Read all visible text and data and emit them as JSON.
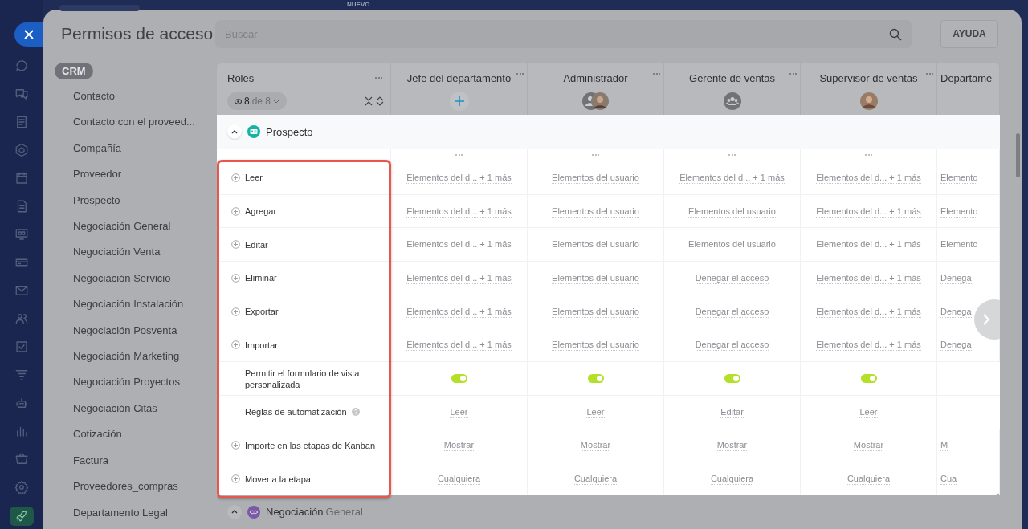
{
  "top_bar": {
    "badge": "NUEVO"
  },
  "title": "Permisos de acceso",
  "search": {
    "placeholder": "Buscar"
  },
  "help_button": "AYUDA",
  "nav": {
    "section": "CRM",
    "items": [
      "Contacto",
      "Contacto con el proveed...",
      "Compañía",
      "Proveedor",
      "Prospecto",
      "Negociación General",
      "Negociación Venta",
      "Negociación Servicio",
      "Negociación Instalación",
      "Negociación Posventa",
      "Negociación Marketing",
      "Negociación Proyectos",
      "Negociación Citas",
      "Cotización",
      "Factura",
      "Proveedores_compras",
      "Departamento Legal"
    ]
  },
  "roles_header": {
    "label": "Roles",
    "visible": "8",
    "total": "de 8"
  },
  "role_columns": [
    {
      "name": "Jefe del departamento",
      "kind": "add"
    },
    {
      "name": "Administrador",
      "kind": "pair"
    },
    {
      "name": "Gerente de ventas",
      "kind": "group"
    },
    {
      "name": "Supervisor de ventas",
      "kind": "person"
    },
    {
      "name": "Departame",
      "kind": "partial"
    }
  ],
  "group": {
    "name": "Prospecto",
    "expanded": true
  },
  "rows": [
    {
      "label": "Leer",
      "kind": "expandable",
      "cells": [
        {
          "kind": "text",
          "text": "Elementos del d... + 1 más"
        },
        {
          "kind": "text",
          "text": "Elementos del usuario"
        },
        {
          "kind": "text",
          "text": "Elementos del d... + 1 más"
        },
        {
          "kind": "text",
          "text": "Elementos del d... + 1 más"
        },
        {
          "kind": "text",
          "text": "Elemento"
        }
      ]
    },
    {
      "label": "Agregar",
      "kind": "expandable",
      "cells": [
        {
          "kind": "text",
          "text": "Elementos del d... + 1 más"
        },
        {
          "kind": "text",
          "text": "Elementos del usuario"
        },
        {
          "kind": "text",
          "text": "Elementos del usuario"
        },
        {
          "kind": "text",
          "text": "Elementos del d... + 1 más"
        },
        {
          "kind": "text",
          "text": "Elemento"
        }
      ]
    },
    {
      "label": "Editar",
      "kind": "expandable",
      "cells": [
        {
          "kind": "text",
          "text": "Elementos del d... + 1 más"
        },
        {
          "kind": "text",
          "text": "Elementos del usuario"
        },
        {
          "kind": "text",
          "text": "Elementos del usuario"
        },
        {
          "kind": "text",
          "text": "Elementos del d... + 1 más"
        },
        {
          "kind": "text",
          "text": "Elemento"
        }
      ]
    },
    {
      "label": "Eliminar",
      "kind": "expandable",
      "cells": [
        {
          "kind": "text",
          "text": "Elementos del d... + 1 más"
        },
        {
          "kind": "text",
          "text": "Elementos del usuario"
        },
        {
          "kind": "text",
          "text": "Denegar el acceso"
        },
        {
          "kind": "text",
          "text": "Elementos del d... + 1 más"
        },
        {
          "kind": "text",
          "text": "Denega"
        }
      ]
    },
    {
      "label": "Exportar",
      "kind": "expandable",
      "cells": [
        {
          "kind": "text",
          "text": "Elementos del d... + 1 más"
        },
        {
          "kind": "text",
          "text": "Elementos del usuario"
        },
        {
          "kind": "text",
          "text": "Denegar el acceso"
        },
        {
          "kind": "text",
          "text": "Elementos del d... + 1 más"
        },
        {
          "kind": "text",
          "text": "Denega"
        }
      ]
    },
    {
      "label": "Importar",
      "kind": "expandable",
      "cells": [
        {
          "kind": "text",
          "text": "Elementos del d... + 1 más"
        },
        {
          "kind": "text",
          "text": "Elementos del usuario"
        },
        {
          "kind": "text",
          "text": "Denegar el acceso"
        },
        {
          "kind": "text",
          "text": "Elementos del d... + 1 más"
        },
        {
          "kind": "text",
          "text": "Denega"
        }
      ]
    },
    {
      "label": "Permitir el formulario de vista personalizada",
      "kind": "plain",
      "cells": [
        {
          "kind": "toggle",
          "on": true
        },
        {
          "kind": "toggle",
          "on": true
        },
        {
          "kind": "toggle",
          "on": true
        },
        {
          "kind": "toggle",
          "on": true
        }
      ]
    },
    {
      "label": "Reglas de automatización",
      "kind": "help",
      "cells": [
        {
          "kind": "text",
          "text": "Leer"
        },
        {
          "kind": "text",
          "text": "Leer"
        },
        {
          "kind": "text",
          "text": "Editar"
        },
        {
          "kind": "text",
          "text": "Leer"
        }
      ]
    },
    {
      "label": "Importe en las etapas de Kanban",
      "kind": "expandable",
      "cells": [
        {
          "kind": "text",
          "text": "Mostrar"
        },
        {
          "kind": "text",
          "text": "Mostrar"
        },
        {
          "kind": "text",
          "text": "Mostrar"
        },
        {
          "kind": "text",
          "text": "Mostrar"
        },
        {
          "kind": "text",
          "text": "M"
        }
      ]
    },
    {
      "label": "Mover a la etapa",
      "kind": "expandable",
      "cells": [
        {
          "kind": "text",
          "text": "Cualquiera"
        },
        {
          "kind": "text",
          "text": "Cualquiera"
        },
        {
          "kind": "text",
          "text": "Cualquiera"
        },
        {
          "kind": "text",
          "text": "Cualquiera"
        },
        {
          "kind": "text",
          "text": "Cua"
        }
      ]
    }
  ],
  "next_group": {
    "name": "Negociación",
    "subtitle": "General"
  }
}
